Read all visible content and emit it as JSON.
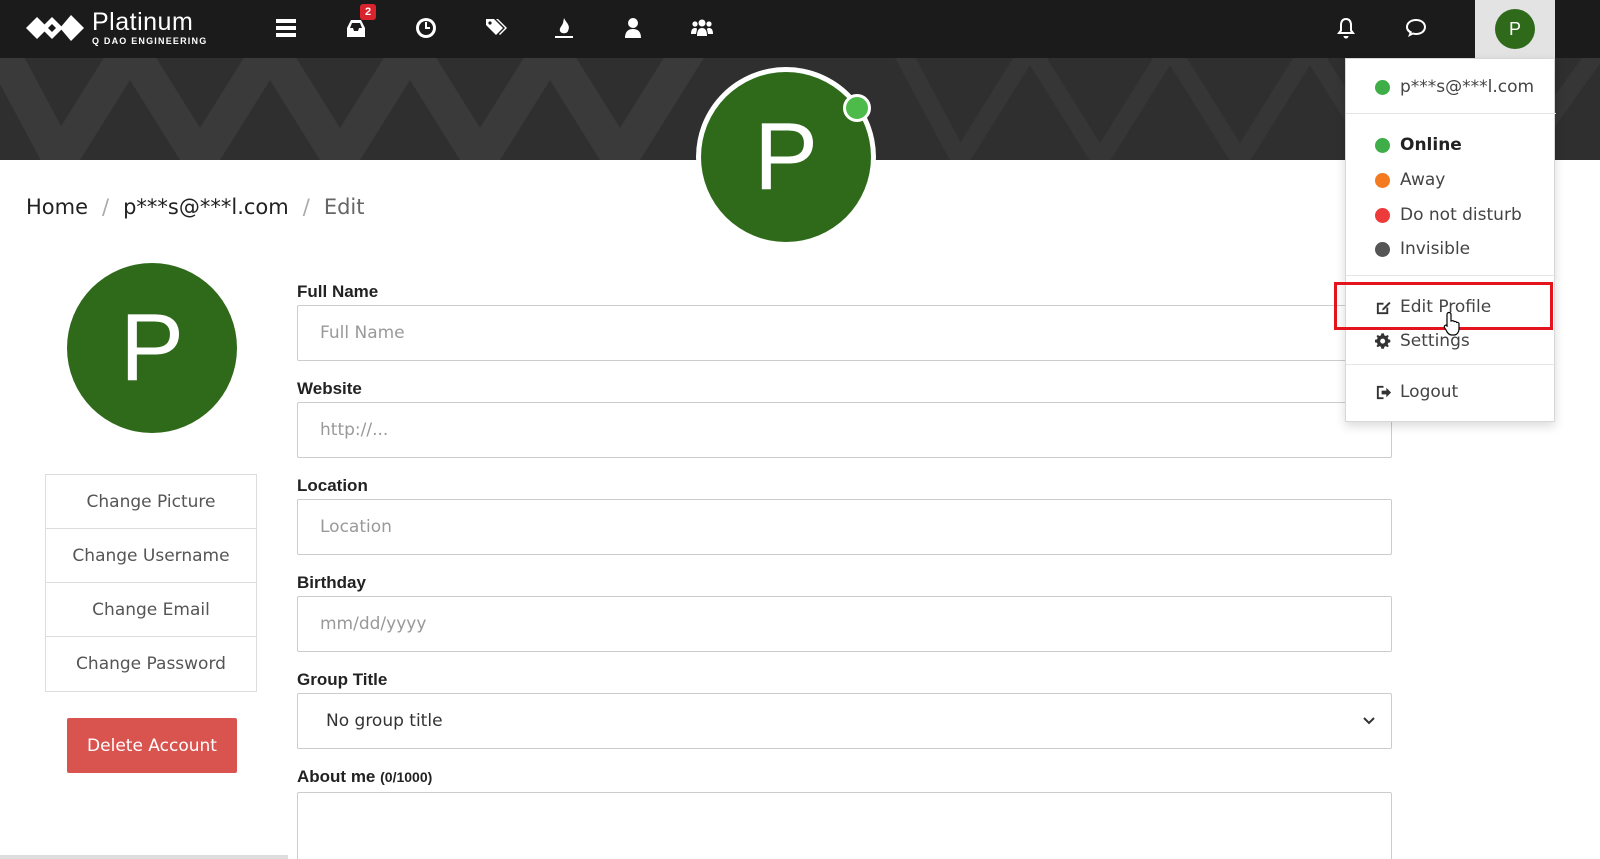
{
  "brand": {
    "name": "Platinum",
    "subtitle": "Q DAO ENGINEERING"
  },
  "navbar": {
    "icons": [
      {
        "name": "categories-icon"
      },
      {
        "name": "unread-icon",
        "badge": "2"
      },
      {
        "name": "recent-icon"
      },
      {
        "name": "tags-icon"
      },
      {
        "name": "popular-icon"
      },
      {
        "name": "users-icon"
      },
      {
        "name": "groups-icon"
      }
    ],
    "notifications_icon": "bell-icon",
    "chat_icon": "chat-icon",
    "user_initial": "P"
  },
  "profile": {
    "initial": "P",
    "status_color": "#4cbb4a",
    "avatar_color": "#2e6a1a"
  },
  "breadcrumb": {
    "home": "Home",
    "user": "p***s@***l.com",
    "current": "Edit"
  },
  "sidebar": {
    "items": [
      "Change Picture",
      "Change Username",
      "Change Email",
      "Change Password"
    ],
    "delete_label": "Delete Account"
  },
  "form": {
    "fullname": {
      "label": "Full Name",
      "placeholder": "Full Name"
    },
    "website": {
      "label": "Website",
      "placeholder": "http://..."
    },
    "location": {
      "label": "Location",
      "placeholder": "Location"
    },
    "birthday": {
      "label": "Birthday",
      "placeholder": "mm/dd/yyyy"
    },
    "group_title": {
      "label": "Group Title",
      "value": "No group title"
    },
    "about": {
      "label": "About me",
      "counter": "(0/1000)"
    }
  },
  "dropdown": {
    "email": "p***s@***l.com",
    "statuses": [
      {
        "label": "Online",
        "color": "#3fae49"
      },
      {
        "label": "Away",
        "color": "#f47a20"
      },
      {
        "label": "Do not disturb",
        "color": "#ed3b3b"
      },
      {
        "label": "Invisible",
        "color": "#555555"
      }
    ],
    "edit_profile": "Edit Profile",
    "settings": "Settings",
    "logout": "Logout"
  }
}
